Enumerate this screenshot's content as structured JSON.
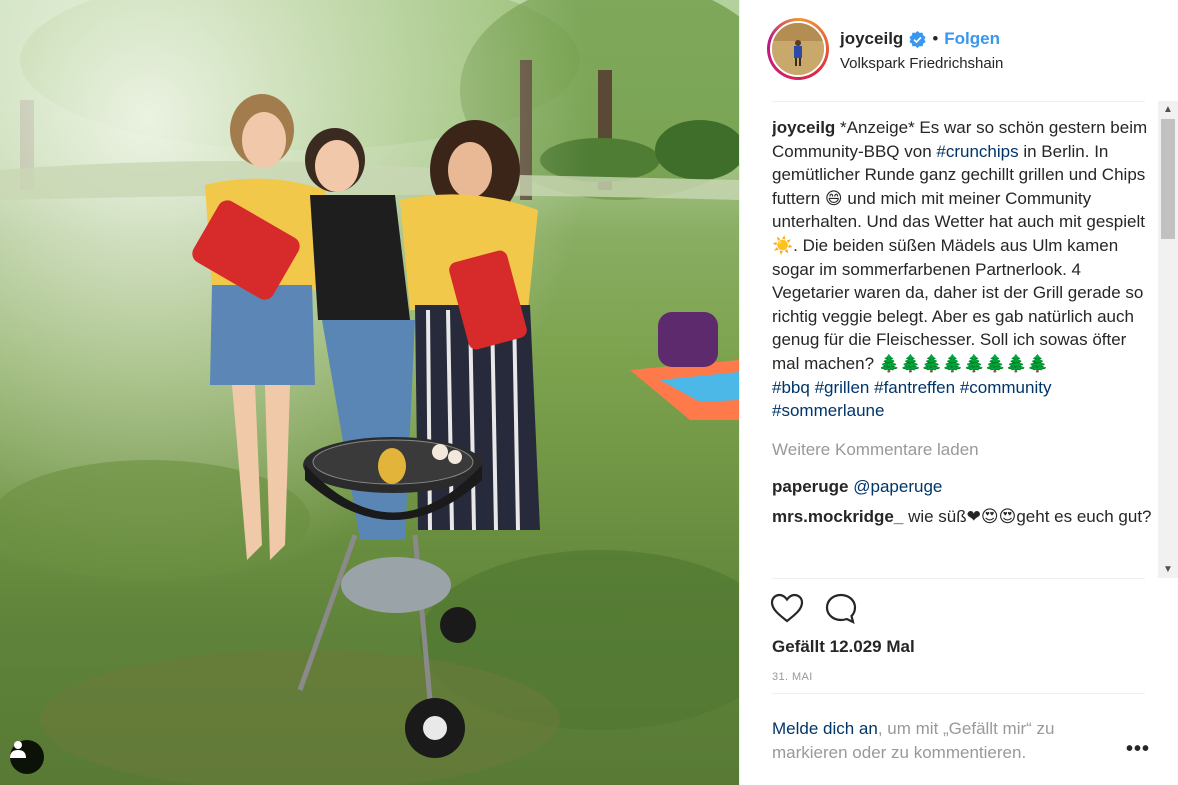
{
  "post": {
    "username": "joyceilg",
    "follow_label": "Folgen",
    "separator": "•",
    "location": "Volkspark Friedrichshain"
  },
  "caption": {
    "username": "joyceilg",
    "text_1": " *Anzeige* Es war so schön gestern beim Community-BBQ von ",
    "hashtag_1": "#crunchips",
    "text_2": " in Berlin. In gemütlicher Runde ganz gechillt grillen und Chips futtern 😄 und mich mit meiner Community unterhalten. Und das Wetter hat auch mit gespielt ☀️. Die beiden süßen Mädels aus Ulm kamen sogar im sommerfarbenen Partnerlook. 4 Vegetarier waren da, daher ist der Grill gerade so richtig veggie belegt. Aber es gab natürlich auch genug für die Fleischesser. Soll ich sowas öfter mal machen? ",
    "trees": "🌲🌲🌲🌲🌲🌲🌲🌲",
    "hashtags": [
      "#bbq",
      "#grillen",
      "#fantreffen",
      "#community",
      "#sommerlaune"
    ]
  },
  "load_more_label": "Weitere Kommentare laden",
  "comments": [
    {
      "username": "paperuge",
      "mention": "@paperuge",
      "text": ""
    },
    {
      "username": "mrs.mockridge_",
      "mention": "",
      "text": "wie süß❤😍😍geht es euch gut?"
    }
  ],
  "likes_label": "Gefällt 12.029 Mal",
  "date_label": "31. MAI",
  "login": {
    "link": "Melde dich an",
    "text": ", um mit „Gefällt mir“ zu markieren oder zu kommentieren."
  },
  "more_label": "•••",
  "scrollbar": {
    "up": "▲",
    "down": "▼"
  },
  "icons": {
    "verified": "verified-badge-icon",
    "like": "heart-icon",
    "comment": "comment-bubble-icon",
    "tag": "user-tag-icon"
  },
  "colors": {
    "link_blue": "#3897f0",
    "hashtag": "#003569",
    "muted": "#999999",
    "text": "#262626"
  }
}
